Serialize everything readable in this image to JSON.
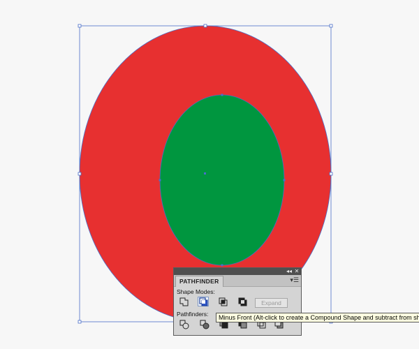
{
  "canvas": {
    "colors": {
      "outer_ellipse": "#e73030",
      "inner_ellipse": "#00963f",
      "selection": "#4a6fc9",
      "background": "#f7f7f7"
    }
  },
  "pathfinder_panel": {
    "tab_title": "PATHFINDER",
    "collapse_icon": "double-chevron-icon",
    "close_icon": "close-icon",
    "menu_icon": "panel-menu-icon",
    "shape_modes_label": "Shape Modes:",
    "shape_modes": [
      {
        "name": "unite",
        "icon": "unite-icon"
      },
      {
        "name": "minus-front",
        "icon": "minus-front-icon",
        "active": true
      },
      {
        "name": "intersect",
        "icon": "intersect-icon"
      },
      {
        "name": "exclude",
        "icon": "exclude-icon"
      }
    ],
    "expand_label": "Expand",
    "pathfinders_label": "Pathfinders:",
    "pathfinders": [
      {
        "name": "divide",
        "icon": "divide-icon"
      },
      {
        "name": "trim",
        "icon": "trim-icon"
      },
      {
        "name": "merge",
        "icon": "merge-icon"
      },
      {
        "name": "crop",
        "icon": "crop-icon"
      },
      {
        "name": "outline",
        "icon": "outline-icon"
      },
      {
        "name": "minus-back",
        "icon": "minus-back-icon"
      }
    ]
  },
  "tooltip": {
    "text": "Minus Front (Alt-click to create a Compound Shape and subtract from shap"
  }
}
